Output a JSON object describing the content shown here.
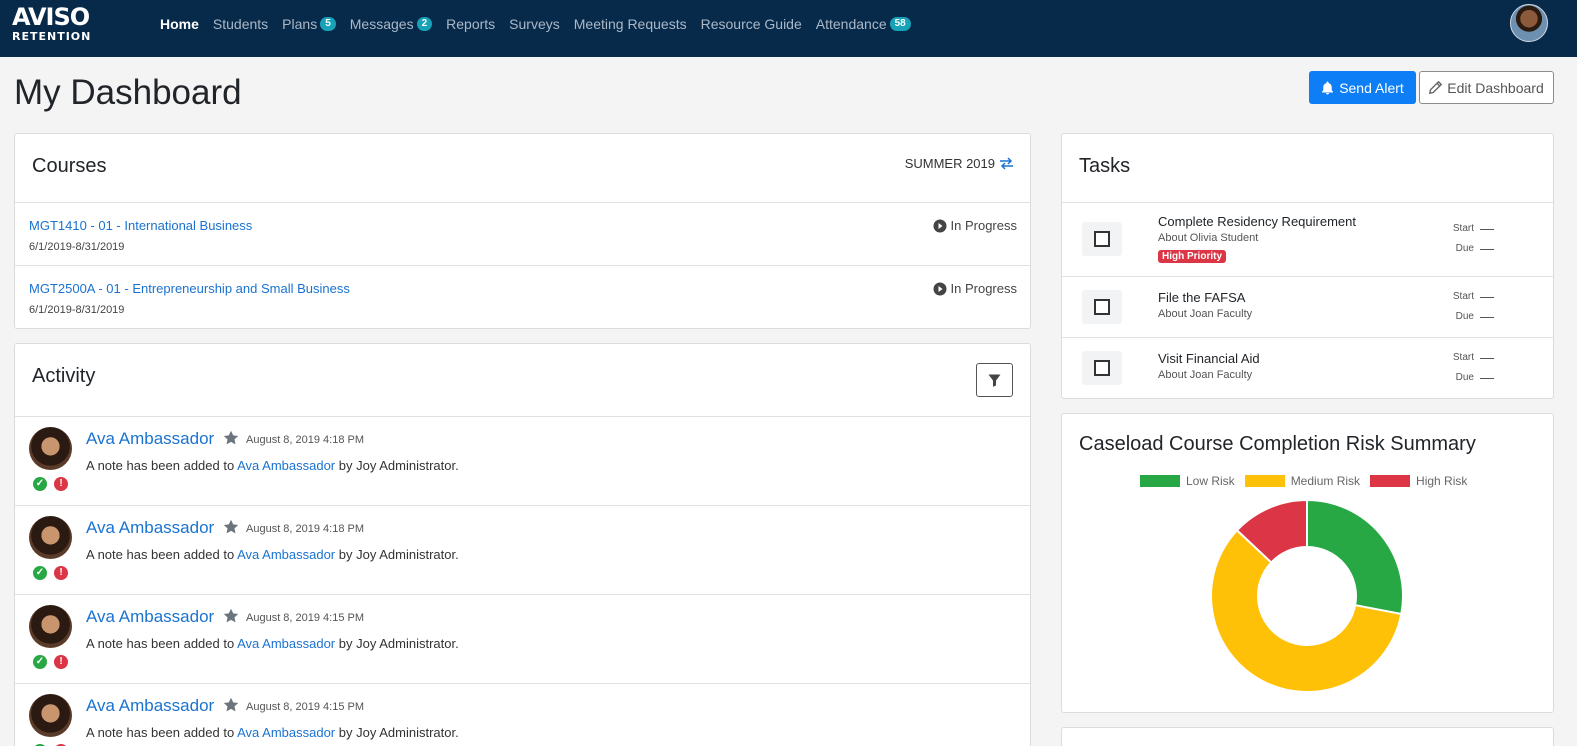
{
  "app": {
    "logo_top": "AVISO",
    "logo_bottom": "RETENTION"
  },
  "nav": [
    {
      "label": "Home",
      "active": true,
      "badge": null
    },
    {
      "label": "Students",
      "badge": null
    },
    {
      "label": "Plans",
      "badge": "5"
    },
    {
      "label": "Messages",
      "badge": "2"
    },
    {
      "label": "Reports",
      "badge": null
    },
    {
      "label": "Surveys",
      "badge": null
    },
    {
      "label": "Meeting Requests",
      "badge": null
    },
    {
      "label": "Resource Guide",
      "badge": null
    },
    {
      "label": "Attendance",
      "badge": "58"
    }
  ],
  "header": {
    "title": "My Dashboard",
    "send_alert": "Send Alert",
    "edit_dashboard": "Edit Dashboard"
  },
  "courses": {
    "title": "Courses",
    "term": "SUMMER 2019",
    "items": [
      {
        "name": "MGT1410 - 01 - International Business",
        "dates": "6/1/2019-8/31/2019",
        "status": "In Progress"
      },
      {
        "name": "MGT2500A - 01 - Entrepreneurship and Small Business",
        "dates": "6/1/2019-8/31/2019",
        "status": "In Progress"
      }
    ]
  },
  "activity": {
    "title": "Activity",
    "items": [
      {
        "name": "Ava Ambassador",
        "time": "August 8, 2019 4:18 PM",
        "text_pre": "A note has been added to",
        "link": "Ava Ambassador",
        "text_post": "by Joy Administrator."
      },
      {
        "name": "Ava Ambassador",
        "time": "August 8, 2019 4:18 PM",
        "text_pre": "A note has been added to",
        "link": "Ava Ambassador",
        "text_post": "by Joy Administrator."
      },
      {
        "name": "Ava Ambassador",
        "time": "August 8, 2019 4:15 PM",
        "text_pre": "A note has been added to",
        "link": "Ava Ambassador",
        "text_post": "by Joy Administrator."
      },
      {
        "name": "Ava Ambassador",
        "time": "August 8, 2019 4:15 PM",
        "text_pre": "A note has been added to",
        "link": "Ava Ambassador",
        "text_post": "by Joy Administrator."
      }
    ]
  },
  "tasks": {
    "title": "Tasks",
    "start_label": "Start",
    "due_label": "Due",
    "items": [
      {
        "title": "Complete Residency Requirement",
        "about": "About Olivia Student",
        "badge": "High Priority"
      },
      {
        "title": "File the FAFSA",
        "about": "About Joan Faculty",
        "badge": null
      },
      {
        "title": "Visit Financial Aid",
        "about": "About Joan Faculty",
        "badge": null
      }
    ]
  },
  "chart_data": {
    "type": "pie",
    "title": "Caseload Course Completion Risk Summary",
    "legend_position": "top",
    "categories": [
      "Low Risk",
      "Medium Risk",
      "High Risk"
    ],
    "values": [
      28,
      59,
      13
    ],
    "colors": [
      "#28a745",
      "#ffc107",
      "#dc3545"
    ]
  }
}
